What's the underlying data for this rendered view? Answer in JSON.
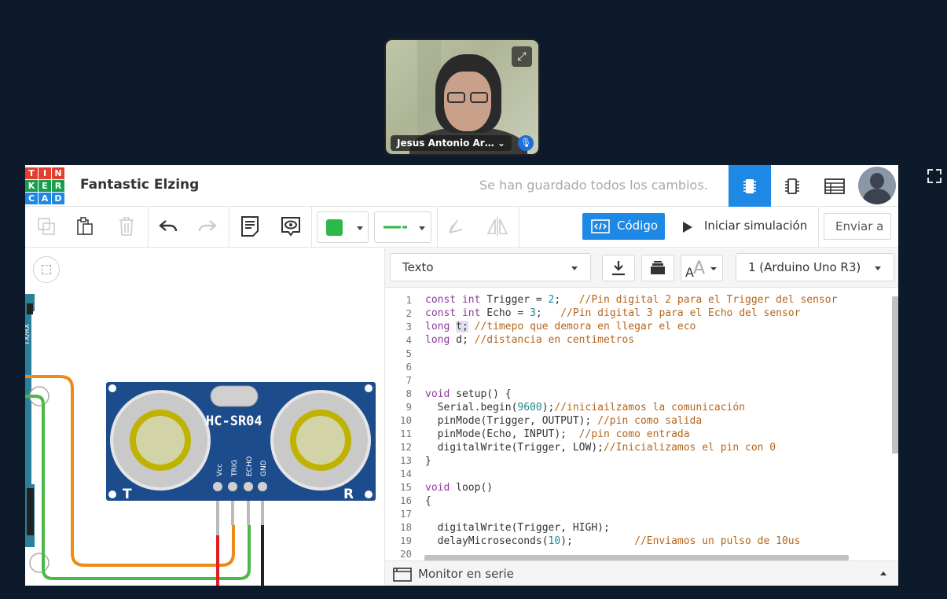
{
  "meeting": {
    "participant_name": "Jesus Antonio Ar…"
  },
  "app": {
    "logo_letters": [
      "T",
      "I",
      "N",
      "K",
      "E",
      "R",
      "C",
      "A",
      "D"
    ],
    "logo_colors": [
      "#e2402f",
      "#e2402f",
      "#e2402f",
      "#1a9e4b",
      "#1a9e4b",
      "#1a9e4b",
      "#1e88e5",
      "#1e88e5",
      "#1e88e5"
    ],
    "project_title": "Fantastic Elzing",
    "save_status": "Se han guardado todos los cambios.",
    "accent_color": "#1e88e5"
  },
  "toolbar": {
    "code_label": "Código",
    "simulate_label": "Iniciar simulación",
    "send_label": "Enviar a",
    "fill_color": "#2fb84a"
  },
  "code_panel": {
    "mode_label": "Texto",
    "board_label": "1 (Arduino Uno R3)",
    "serial_monitor_label": "Monitor en serie",
    "line_numbers": [
      "1",
      "2",
      "3",
      "4",
      "5",
      "6",
      "7",
      "8",
      "9",
      "10",
      "11",
      "12",
      "13",
      "14",
      "15",
      "16",
      "17",
      "18",
      "19",
      "20"
    ]
  },
  "circuit": {
    "sensor_label": "HC-SR04",
    "pin_labels": [
      "Vcc",
      "TRIG",
      "ECHO",
      "GND"
    ],
    "side_left": "T",
    "side_right": "R",
    "board_edge_text": "TX/RX"
  }
}
